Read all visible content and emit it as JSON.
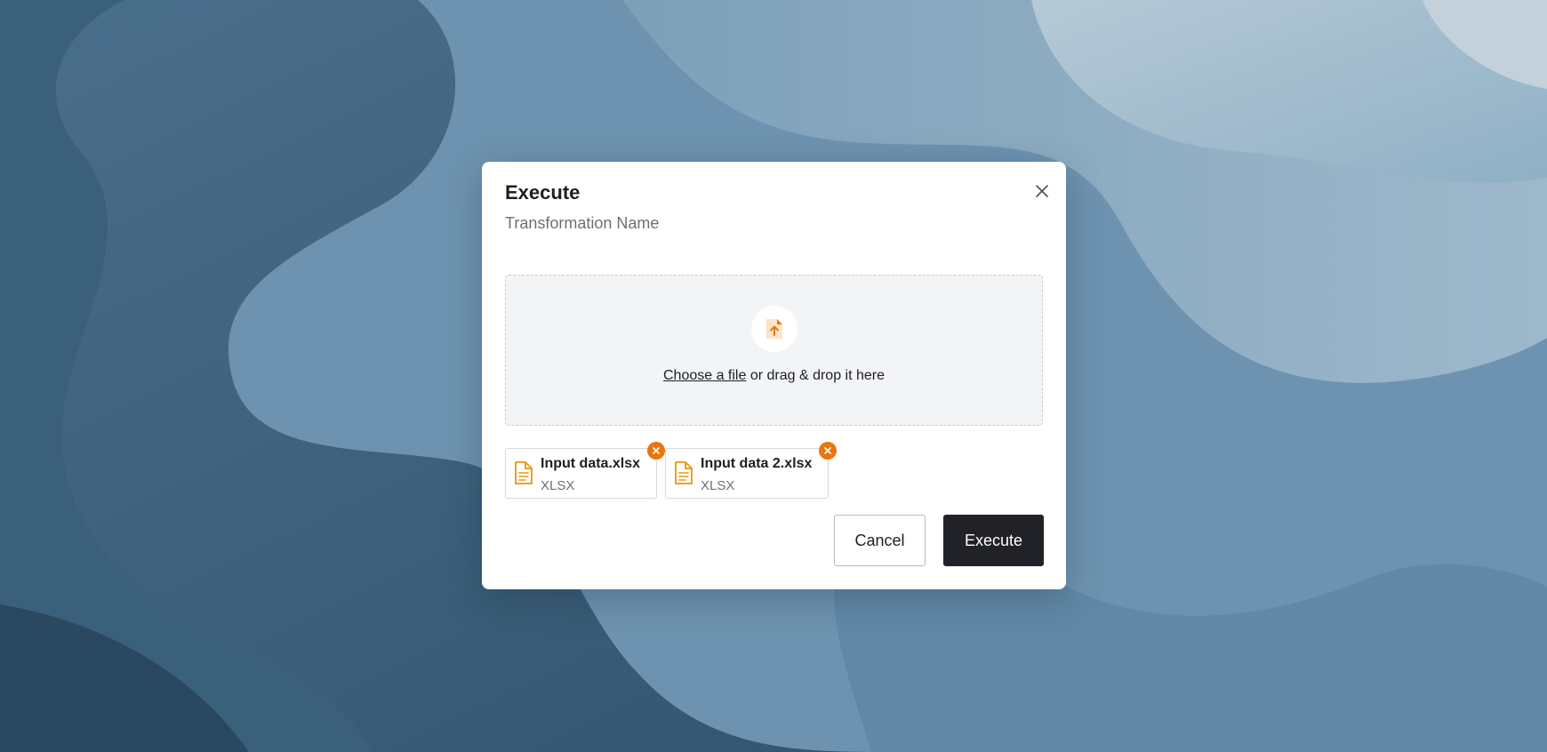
{
  "modal": {
    "title": "Execute",
    "subtitle": "Transformation Name",
    "close_icon": "close-icon"
  },
  "dropzone": {
    "icon": "file-upload-icon",
    "link_text": "Choose a file",
    "rest_text": " or drag & drop it here"
  },
  "files": [
    {
      "name": "Input data.xlsx",
      "type": "XLSX",
      "icon": "document-icon",
      "remove_icon": "remove-icon"
    },
    {
      "name": "Input data 2.xlsx",
      "type": "XLSX",
      "icon": "document-icon",
      "remove_icon": "remove-icon"
    }
  ],
  "actions": {
    "cancel_label": "Cancel",
    "execute_label": "Execute"
  },
  "colors": {
    "accent": "#e8760e",
    "primary_button": "#202227",
    "dropzone_bg": "#f3f4f6"
  }
}
